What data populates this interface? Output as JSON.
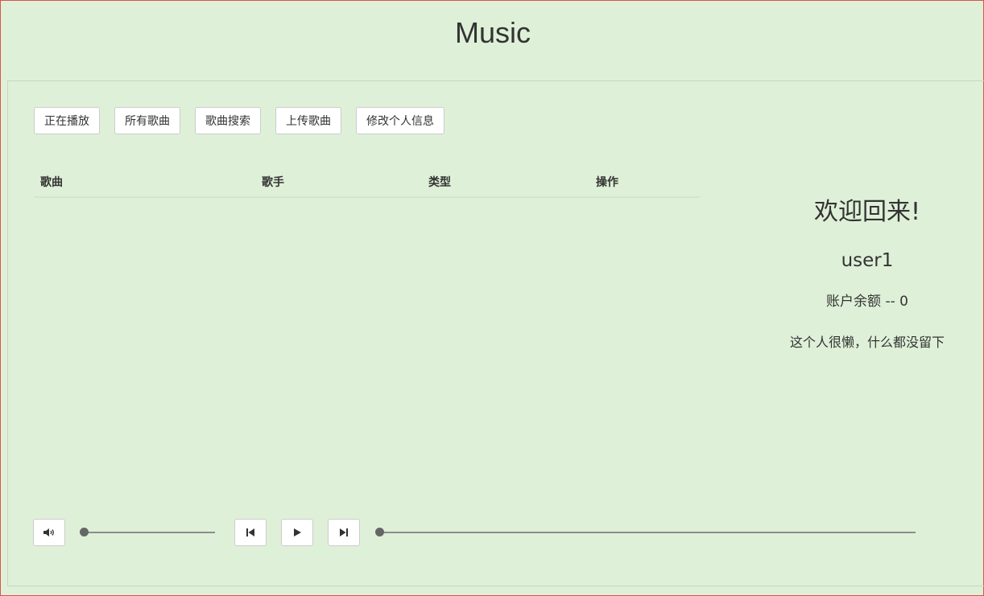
{
  "app": {
    "title": "Music"
  },
  "nav": {
    "items": [
      {
        "label": "正在播放"
      },
      {
        "label": "所有歌曲"
      },
      {
        "label": "歌曲搜索"
      },
      {
        "label": "上传歌曲"
      },
      {
        "label": "修改个人信息"
      }
    ]
  },
  "table": {
    "columns": [
      "歌曲",
      "歌手",
      "类型",
      "操作"
    ],
    "rows": []
  },
  "profile": {
    "welcome": "欢迎回来!",
    "username": "user1",
    "balance": "账户余额 -- 0",
    "bio": "这个人很懒，什么都没留下"
  },
  "player": {
    "icons": [
      "volume-icon",
      "previous-icon",
      "play-icon",
      "next-icon"
    ],
    "volume_level": 0,
    "progress": 0
  },
  "colors": {
    "background": "#dff0d8",
    "button_bg": "#ffffff",
    "button_border": "#cccccc",
    "text": "#333333"
  }
}
